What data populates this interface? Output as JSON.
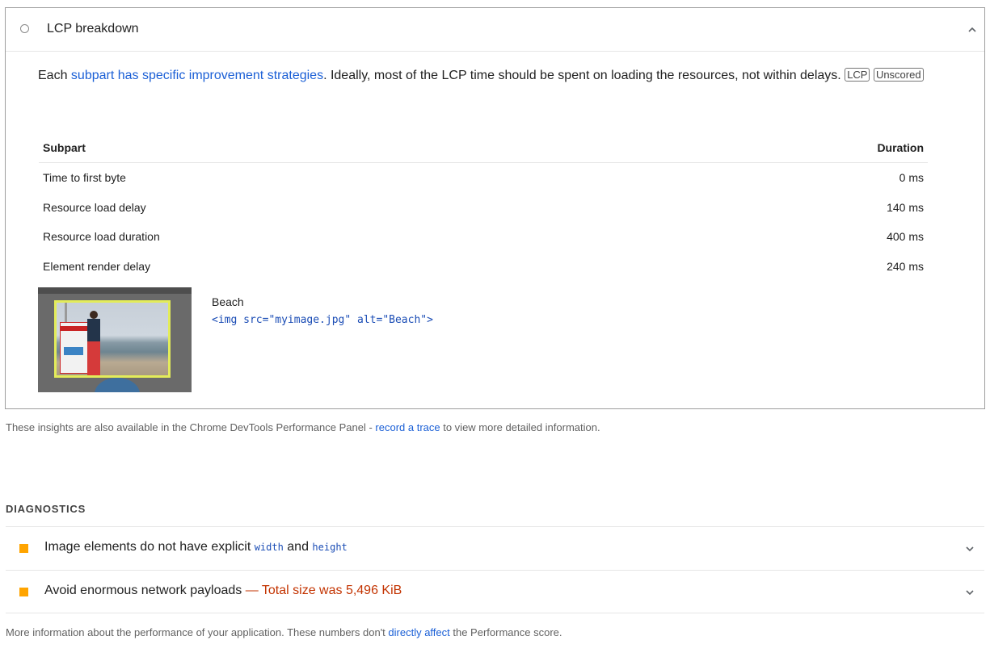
{
  "lcp": {
    "title": "LCP breakdown",
    "desc_prefix": "Each ",
    "desc_link": "subpart has specific improvement strategies",
    "desc_suffix": ". Ideally, most of the LCP time should be spent on loading the resources, not within delays.",
    "tag_lcp": "LCP",
    "tag_unscored": "Unscored",
    "table": {
      "headers": [
        "Subpart",
        "Duration"
      ],
      "rows": [
        {
          "subpart": "Time to first byte",
          "duration": "0 ms"
        },
        {
          "subpart": "Resource load delay",
          "duration": "140 ms"
        },
        {
          "subpart": "Resource load duration",
          "duration": "400 ms"
        },
        {
          "subpart": "Element render delay",
          "duration": "240 ms"
        }
      ]
    },
    "element": {
      "label": "Beach",
      "snippet": "<img src=\"myimage.jpg\" alt=\"Beach\">"
    }
  },
  "insights_note": {
    "prefix": "These insights are also available in the Chrome DevTools Performance Panel - ",
    "link": "record a trace",
    "suffix": " to view more detailed information."
  },
  "diagnostics": {
    "title": "DIAGNOSTICS",
    "items": [
      {
        "pre": "Image elements do not have explicit ",
        "code1": "width",
        "mid": " and ",
        "code2": "height"
      },
      {
        "title": "Avoid enormous network payloads",
        "display_value": " — Total size was 5,496 KiB"
      }
    ]
  },
  "more_info": {
    "prefix": "More information about the performance of your application. These numbers don't ",
    "link": "directly affect",
    "suffix": " the Performance score."
  },
  "colors": {
    "link": "#1a5fd6",
    "warning_square": "#ffa400",
    "warning_text": "#c33300",
    "code": "#1a4cb5"
  }
}
